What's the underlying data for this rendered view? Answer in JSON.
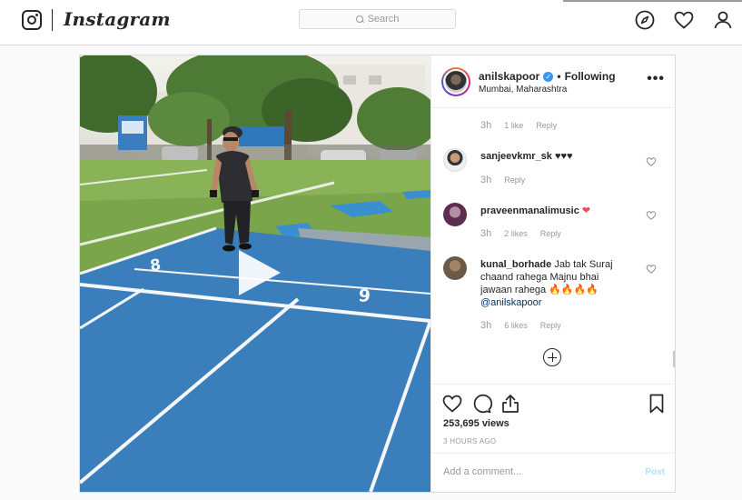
{
  "nav": {
    "brand": "Instagram",
    "search_placeholder": "Search",
    "icons": [
      "instagram-glyph-icon",
      "compass-icon",
      "heart-icon",
      "profile-icon"
    ]
  },
  "post": {
    "author": "anilskapoor",
    "separator": "•",
    "follow_status": "Following",
    "location": "Mumbai, Maharashtra",
    "more": "•••",
    "views": "253,695 views",
    "time": "3 HOURS AGO",
    "add_comment_placeholder": "Add a comment...",
    "post_label": "Post"
  },
  "comments": [
    {
      "username": "",
      "text": "",
      "age": "3h",
      "likes": "1 like",
      "reply": "Reply"
    },
    {
      "username": "sanjeevkmr_sk",
      "text": "♥♥♥",
      "age": "3h",
      "likes": "",
      "reply": "Reply"
    },
    {
      "username": "praveenmanalimusic",
      "text": "❤",
      "age": "3h",
      "likes": "2 likes",
      "reply": "Reply"
    },
    {
      "username": "kunal_borhade",
      "text": "Jab tak Suraj chaand rahega Majnu bhai jawaan rahega 🔥🔥🔥🔥",
      "mention": "@anilskapoor",
      "age": "3h",
      "likes": "6 likes",
      "reply": "Reply"
    }
  ],
  "colors": {
    "link": "#003569",
    "verified": "#3897f0",
    "muted": "#999999",
    "border": "#dbdbdb"
  }
}
